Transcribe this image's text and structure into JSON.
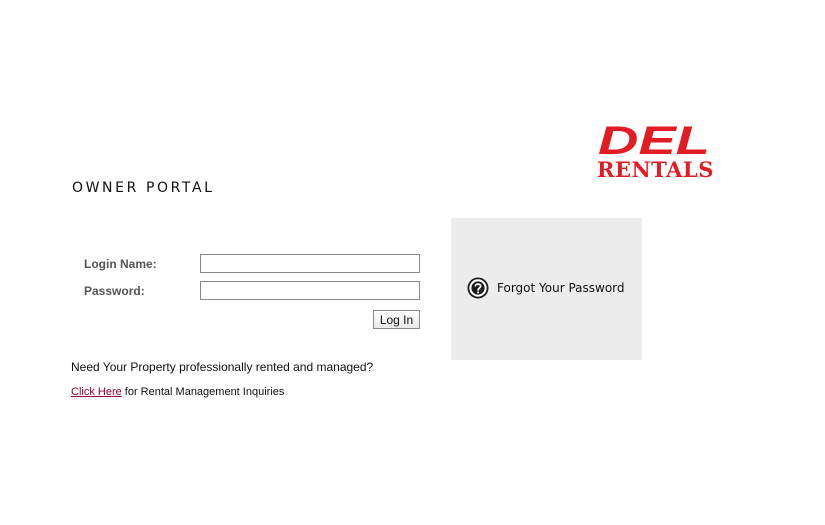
{
  "brand": {
    "logo_main": "DEL",
    "logo_sub": "RENTALS",
    "color": "#e31b23"
  },
  "portal": {
    "title": "OWNER PORTAL"
  },
  "login_form": {
    "login_name_label": "Login Name:",
    "login_name_value": "",
    "password_label": "Password:",
    "password_value": "",
    "submit_label": "Log In"
  },
  "forgot": {
    "icon": "question-mark-circle-icon",
    "label": "Forgot Your Password"
  },
  "promo": {
    "question": "Need Your Property professionally rented and managed?",
    "link_label": "Click Here",
    "link_color": "#990033",
    "after_link": " for Rental Management Inquiries"
  }
}
